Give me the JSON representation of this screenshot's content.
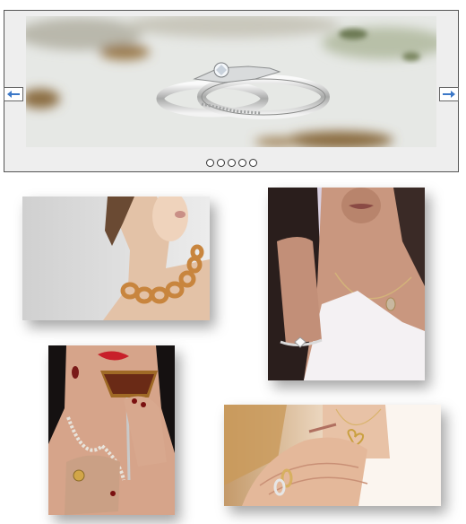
{
  "carousel": {
    "slide_count": 5,
    "active_slide": 1,
    "slides": [
      "rings-slide"
    ],
    "prev_icon": "arrow-left-icon",
    "next_icon": "arrow-right-icon",
    "arrow_color": "#3c78c8"
  },
  "gallery": {
    "items": [
      "necklace-photo",
      "bracelet-photo",
      "ring-drink-photo",
      "hand-rings-photo"
    ]
  }
}
